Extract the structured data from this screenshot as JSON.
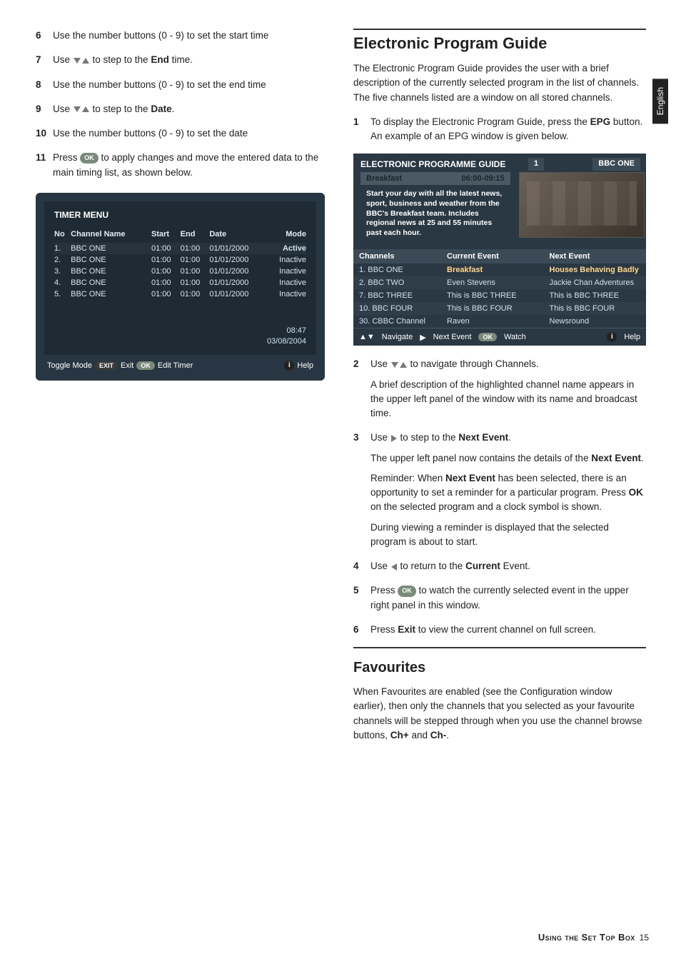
{
  "side_tab": "English",
  "left": {
    "steps": [
      {
        "n": "6",
        "text": "Use the number buttons (0 - 9) to set the start time"
      },
      {
        "n": "7",
        "pre": "Use ",
        "post": " to step to the ",
        "bold": "End",
        "after": " time."
      },
      {
        "n": "8",
        "text": "Use the number buttons (0 - 9) to set the end time"
      },
      {
        "n": "9",
        "pre": "Use ",
        "post": " to step to the ",
        "bold": "Date",
        "after": "."
      },
      {
        "n": "10",
        "text": "Use the number buttons (0 - 9) to set the date"
      },
      {
        "n": "11",
        "pre": "Press ",
        "post": " to apply changes and move the entered data to the main timing list, as shown below."
      }
    ],
    "timer": {
      "title": "TIMER MENU",
      "headers": {
        "no": "No",
        "name": "Channel Name",
        "start": "Start",
        "end": "End",
        "date": "Date",
        "mode": "Mode"
      },
      "rows": [
        {
          "no": "1.",
          "name": "BBC ONE",
          "start": "01:00",
          "end": "01:00",
          "date": "01/01/2000",
          "mode": "Active"
        },
        {
          "no": "2.",
          "name": "BBC ONE",
          "start": "01:00",
          "end": "01:00",
          "date": "01/01/2000",
          "mode": "Inactive"
        },
        {
          "no": "3.",
          "name": "BBC ONE",
          "start": "01:00",
          "end": "01:00",
          "date": "01/01/2000",
          "mode": "Inactive"
        },
        {
          "no": "4.",
          "name": "BBC ONE",
          "start": "01:00",
          "end": "01:00",
          "date": "01/01/2000",
          "mode": "Inactive"
        },
        {
          "no": "5.",
          "name": "BBC ONE",
          "start": "01:00",
          "end": "01:00",
          "date": "01/01/2000",
          "mode": "Inactive"
        }
      ],
      "time": "08:47",
      "date": "03/08/2004",
      "footer": {
        "toggle": "Toggle Mode",
        "exit_label": "Exit",
        "ok_label": "Edit Timer",
        "help": "Help"
      },
      "pill_exit": "EXIT",
      "pill_ok": "OK"
    }
  },
  "right": {
    "h_epg": "Electronic Program Guide",
    "epg_intro": "The Electronic Program Guide provides the user with a brief description of the currently selected program in the list of channels. The five channels listed are a window on all stored channels.",
    "steps1": [
      {
        "n": "1",
        "pre": "To display the Electronic Program Guide, press the ",
        "bold": "EPG",
        "after": " button. An example of an EPG window is given below."
      }
    ],
    "epg": {
      "title": "ELECTRONIC PROGRAMME GUIDE",
      "num": "1",
      "chname": "BBC ONE",
      "prog": "Breakfast",
      "prog_time": "06:00-09:15",
      "desc": "Start your day with all the latest news, sport, business and weather from the BBC's Breakfast team. Includes regional news at 25 and 55 minutes past each hour.",
      "cols": {
        "ch": "Channels",
        "cur": "Current Event",
        "next": "Next Event"
      },
      "rows": [
        {
          "ch": "1. BBC ONE",
          "cur": "Breakfast",
          "next": "Houses Behaving Badly",
          "hi": true
        },
        {
          "ch": "2. BBC TWO",
          "cur": "Even Stevens",
          "next": "Jackie Chan Adventures"
        },
        {
          "ch": "7. BBC THREE",
          "cur": "This is BBC THREE",
          "next": "This is BBC THREE"
        },
        {
          "ch": "10. BBC FOUR",
          "cur": "This is BBC FOUR",
          "next": "This is BBC FOUR"
        },
        {
          "ch": "30. CBBC Channel",
          "cur": "Raven",
          "next": "Newsround"
        }
      ],
      "footer": {
        "nav": "Navigate",
        "next": "Next Event",
        "watch": "Watch",
        "help": "Help",
        "ok": "OK"
      }
    },
    "steps2": [
      {
        "n": "2",
        "pre": "Use ",
        "post": " to navigate through Channels.",
        "p": "A brief description of the highlighted channel name appears in the upper left panel of the window with its name and broadcast time."
      },
      {
        "n": "3",
        "pre": "Use ",
        "post": " to step to the ",
        "bold": "Next Event",
        "after": ".",
        "p": "The upper left panel now contains the details of the ",
        "pbold": "Next Event",
        "pafter": ".",
        "p2pre": "Reminder: When ",
        "p2bold": "Next Event",
        "p2post": " has been selected, there is an opportunity to set a reminder for a particular program. Press ",
        "p2bold2": "OK",
        "p2after": " on the selected program and a clock symbol is shown.",
        "p3": "During viewing a reminder is displayed that the selected program is about to start."
      },
      {
        "n": "4",
        "pre": "Use ",
        "post": " to return to the ",
        "bold": "Current",
        "after": " Event."
      },
      {
        "n": "5",
        "pre": "Press ",
        "post": " to watch the currently selected event in the upper right panel in this window."
      },
      {
        "n": "6",
        "pre": "Press ",
        "bold": "Exit",
        "after": " to view the current channel on full screen."
      }
    ],
    "h_fav": "Favourites",
    "fav_text_pre": "When Favourites are enabled (see the Configuration window earlier), then only the channels that you selected as your favourite channels will be stepped through when you use the channel browse buttons, ",
    "fav_b1": "Ch+",
    "fav_mid": " and ",
    "fav_b2": "Ch-",
    "fav_after": "."
  },
  "footer": {
    "title": "Using the Set Top Box",
    "page": "15"
  },
  "icons": {
    "ok": "OK",
    "info": "i"
  }
}
